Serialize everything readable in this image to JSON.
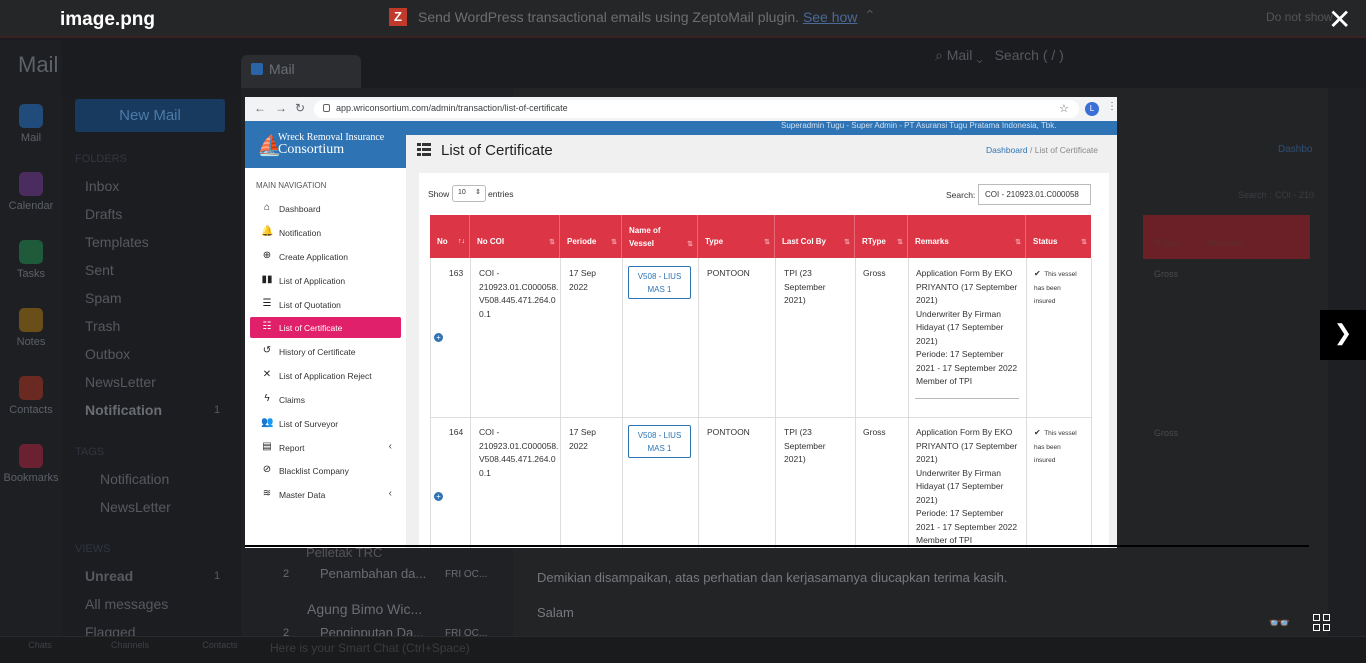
{
  "viewer": {
    "title": "image.png"
  },
  "promo": {
    "text": "Send WordPress transactional emails using ZeptoMail plugin.",
    "link": "See how",
    "dismiss": "Do not show"
  },
  "app": {
    "brand": "Mail",
    "tab": "Mail",
    "new_mail": "New Mail",
    "search_scope": "Mail",
    "search_placeholder": "Search ( / )",
    "smart_chat": "Here is your Smart Chat (Ctrl+Space)"
  },
  "leftnav": [
    "Mail",
    "Calendar",
    "Tasks",
    "Notes",
    "Contacts",
    "Bookmarks"
  ],
  "folders": {
    "heading": "FOLDERS",
    "items": [
      "Inbox",
      "Drafts",
      "Templates",
      "Sent",
      "Spam",
      "Trash",
      "Outbox",
      "NewsLetter",
      "Notification"
    ],
    "notification_count": "1"
  },
  "tags": {
    "heading": "TAGS",
    "items": [
      "Notification",
      "NewsLetter"
    ]
  },
  "views": {
    "heading": "VIEWS",
    "items": [
      "Unread",
      "All messages",
      "Flagged"
    ],
    "unread_count": "1"
  },
  "bottom": [
    "Chats",
    "Channels",
    "Contacts"
  ],
  "maillist": [
    {
      "sender": "Pelletak TRC",
      "count": "",
      "subject": "",
      "date": ""
    },
    {
      "sender": "",
      "count": "2",
      "subject": "Penambahan da...",
      "date": "FRI OC..."
    },
    {
      "sender": "Agung Bimo Wic...",
      "count": "",
      "subject": "",
      "date": ""
    },
    {
      "sender": "",
      "count": "2",
      "subject": "Penginputan Da...",
      "date": "FRI OC..."
    }
  ],
  "reading": {
    "body": "Demikian disampaikan, atas perhatian dan kerjasamanya diucapkan terima kasih.",
    "closing": "Salam",
    "dashboard": "Dashbo",
    "search": "Search :",
    "search_value": "COI - 210",
    "bg_rtype": "RType",
    "bg_remarks": "Remarks",
    "bg_gross": "Gross"
  },
  "shot": {
    "url": "app.wriconsortium.com/admin/transaction/list-of-certificate",
    "avatar": "L",
    "header_user": "Superadmin Tugu - Super Admin - PT Asuransi Tugu Pratama Indonesia, Tbk.",
    "logo_line1": "Wreck Removal Insurance",
    "logo_line2": "Consortium",
    "nav_heading": "MAIN NAVIGATION",
    "nav": [
      {
        "label": "Dashboard",
        "icon": "home-icon"
      },
      {
        "label": "Notification",
        "icon": "bell-icon"
      },
      {
        "label": "Create Application",
        "icon": "plus-circle-icon"
      },
      {
        "label": "List of Application",
        "icon": "book-icon"
      },
      {
        "label": "List of Quotation",
        "icon": "list-icon"
      },
      {
        "label": "List of Certificate",
        "icon": "table-icon"
      },
      {
        "label": "History of Certificate",
        "icon": "history-icon"
      },
      {
        "label": "List of Application Reject",
        "icon": "x-icon"
      },
      {
        "label": "Claims",
        "icon": "bolt-icon"
      },
      {
        "label": "List of Surveyor",
        "icon": "users-icon"
      },
      {
        "label": "Report",
        "icon": "file-icon"
      },
      {
        "label": "Blacklist Company",
        "icon": "ban-icon"
      },
      {
        "label": "Master Data",
        "icon": "database-icon"
      }
    ],
    "page_title": "List of Certificate",
    "breadcrumb_home": "Dashboard",
    "breadcrumb_sep": "/",
    "breadcrumb_current": "List of Certificate",
    "show": "Show",
    "show_value": "10",
    "entries": "entries",
    "search_label": "Search:",
    "search_value": "COI - 210923.01.C000058",
    "columns": [
      "No",
      "No COI",
      "Periode",
      "Name of Vessel",
      "Type",
      "Last CoI By",
      "RType",
      "Remarks",
      "Status"
    ],
    "rows": [
      {
        "no": "163",
        "coi": [
          "COI -",
          "210923.01.C000058.",
          "V508.445.471.264.0",
          "0.1"
        ],
        "periode": [
          "17 Sep",
          "2022"
        ],
        "vessel": [
          "V508 - LIUS",
          "MAS 1"
        ],
        "type": "PONTOON",
        "lastcoi": [
          "TPI (23",
          "September",
          "2021)"
        ],
        "rtype": "Gross",
        "remarks": [
          "Application Form By EKO",
          "PRIYANTO (17 September",
          "2021)",
          "Underwriter By Firman",
          "Hidayat (17 September",
          "2021)",
          "Periode: 17 September",
          "2021 - 17 September 2022",
          "Member of TPI"
        ],
        "status": [
          "This vessel",
          "has been",
          "insured"
        ]
      },
      {
        "no": "164",
        "coi": [
          "COI -",
          "210923.01.C000058.",
          "V508.445.471.264.0",
          "0.1"
        ],
        "periode": [
          "17 Sep",
          "2022"
        ],
        "vessel": [
          "V508 - LIUS",
          "MAS 1"
        ],
        "type": "PONTOON",
        "lastcoi": [
          "TPI (23",
          "September",
          "2021)"
        ],
        "rtype": "Gross",
        "remarks": [
          "Application Form By EKO",
          "PRIYANTO (17 September",
          "2021)",
          "Underwriter By Firman",
          "Hidayat (17 September",
          "2021)",
          "Periode: 17 September",
          "2021 - 17 September 2022",
          "Member of TPI"
        ],
        "status": [
          "This vessel",
          "has been",
          "insured"
        ]
      }
    ]
  },
  "colors": {
    "accent_red": "#dc3545",
    "active_pink": "#e0206a",
    "brand_blue": "#2e74b5"
  }
}
